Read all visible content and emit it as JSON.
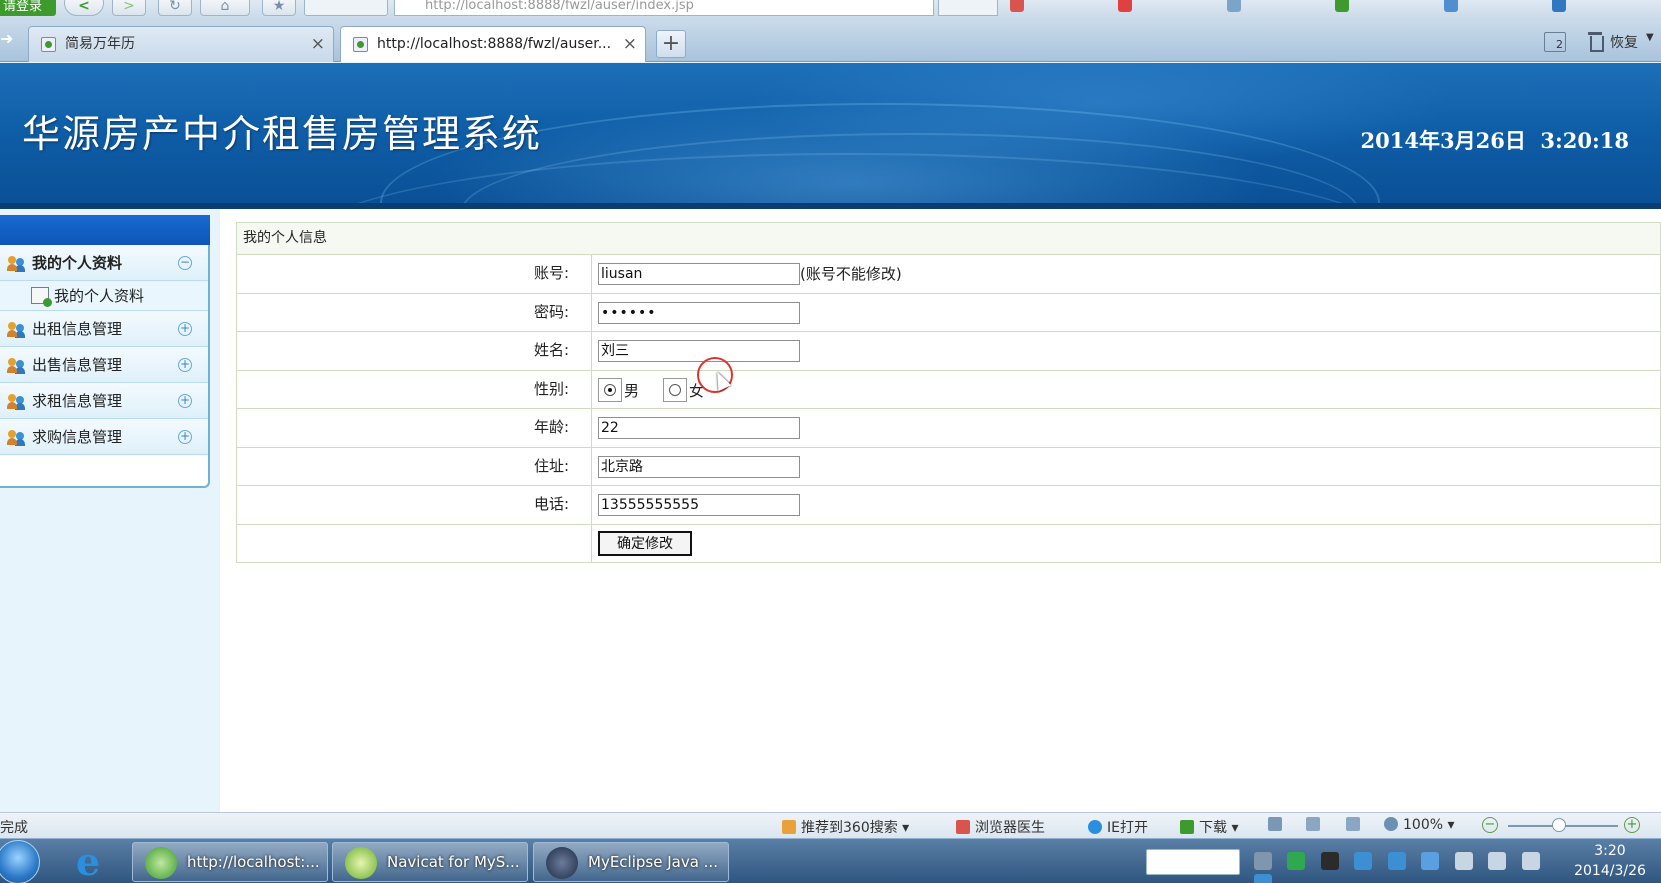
{
  "browser": {
    "login_label": "请登录",
    "address_text": "http://localhost:8888/fwzl/auser/index.jsp",
    "tabs": [
      {
        "title": "简易万年历",
        "active": false
      },
      {
        "title": "http://localhost:8888/fwzl/auser...",
        "active": true
      }
    ],
    "tab_count": "2",
    "restore_label": "恢复"
  },
  "header": {
    "title": "华源房产中介租售房管理系统",
    "datetime": "2014年3月26日  3:20:18"
  },
  "sidebar": {
    "groups": [
      {
        "label": "我的个人资料",
        "expanded": true,
        "items": [
          "我的个人资料"
        ]
      },
      {
        "label": "出租信息管理",
        "expanded": false
      },
      {
        "label": "出售信息管理",
        "expanded": false
      },
      {
        "label": "求租信息管理",
        "expanded": false
      },
      {
        "label": "求购信息管理",
        "expanded": false
      }
    ]
  },
  "form": {
    "caption": "我的个人信息",
    "account": {
      "label": "账号:",
      "value": "liusan",
      "hint": "(账号不能修改)"
    },
    "password": {
      "label": "密码:",
      "value": "••••••"
    },
    "name": {
      "label": "姓名:",
      "value": "刘三"
    },
    "gender": {
      "label": "性别:",
      "options": [
        "男",
        "女"
      ],
      "selected": "男"
    },
    "age": {
      "label": "年龄:",
      "value": "22"
    },
    "address": {
      "label": "住址:",
      "value": "北京路"
    },
    "phone": {
      "label": "电话:",
      "value": "13555555555"
    },
    "submit_label": "确定修改"
  },
  "statusbar": {
    "status_text": "完成",
    "search_recommend": "推荐到360搜索",
    "doctor": "浏览器医生",
    "ie_open": "IE打开",
    "download": "下载",
    "zoom": "100%"
  },
  "taskbar": {
    "buttons": [
      {
        "label": "http://localhost:..."
      },
      {
        "label": "Navicat for MyS..."
      },
      {
        "label": "MyEclipse Java ..."
      }
    ],
    "clock_time": "3:20",
    "clock_date": "2014/3/26"
  }
}
